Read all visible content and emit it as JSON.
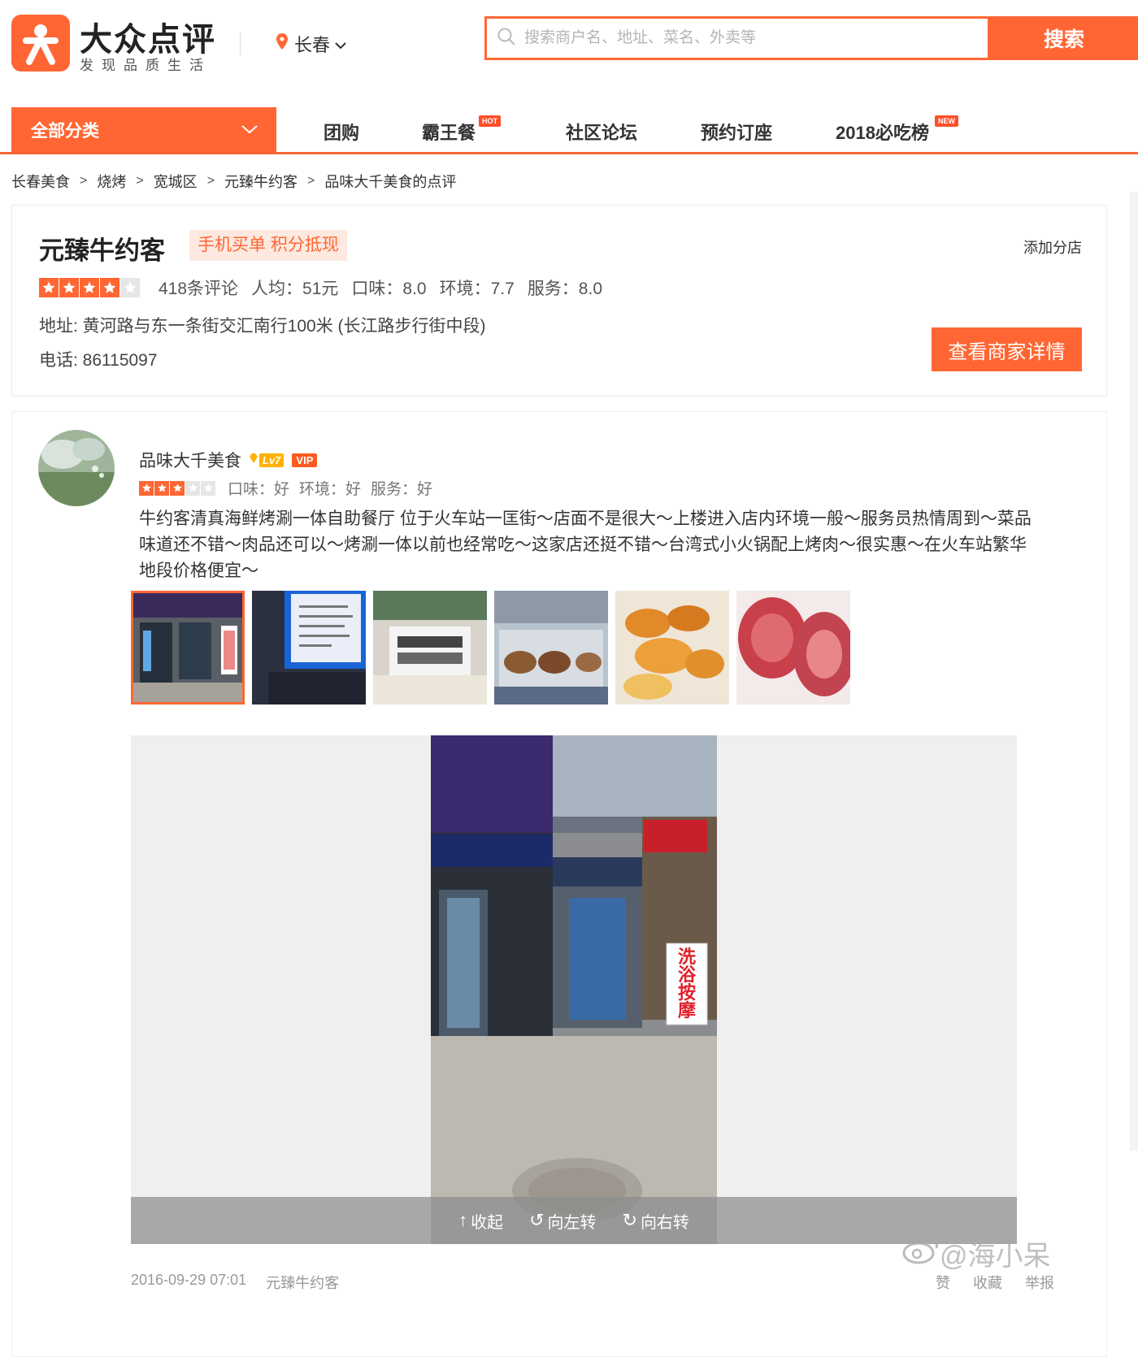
{
  "brand": {
    "name": "大众点评",
    "slogan": "发现品质生活",
    "accent_color": "#ff6633"
  },
  "city": {
    "name": "长春"
  },
  "search": {
    "placeholder": "搜索商户名、地址、菜名、外卖等",
    "button_label": "搜索"
  },
  "nav": {
    "all_categories": "全部分类",
    "items": [
      {
        "label": "团购",
        "badge": ""
      },
      {
        "label": "霸王餐",
        "badge": "HOT"
      },
      {
        "label": "社区论坛",
        "badge": ""
      },
      {
        "label": "预约订座",
        "badge": ""
      },
      {
        "label": "2018必吃榜",
        "badge": "NEW"
      }
    ]
  },
  "breadcrumb": [
    "长春美食",
    "烧烤",
    "宽城区",
    "元臻牛约客",
    "品味大千美食的点评"
  ],
  "shop": {
    "name": "元臻牛约客",
    "tag": "手机买单 积分抵现",
    "add_branch": "添加分店",
    "stars": 4,
    "review_count": "418条评论",
    "avg_price": "人均：51元",
    "taste": "口味：8.0",
    "environment": "环境：7.7",
    "service": "服务：8.0",
    "address": "地址: 黄河路与东一条街交汇南行100米 (长江路步行街中段)",
    "phone": "电话: 86115097",
    "detail_button": "查看商家详情"
  },
  "review": {
    "username": "品味大千美食",
    "level": "Lv7",
    "vip": "VIP",
    "stars": 3,
    "taste": "口味：好",
    "environment": "环境：好",
    "service": "服务：好",
    "text": "牛约客清真海鲜烤涮一体自助餐厅 位于火车站一匡街～店面不是很大～上楼进入店内环境一般～服务员热情周到～菜品味道还不错～肉品还可以～烤涮一体以前也经常吃～这家店还挺不错～台湾式小火锅配上烤肉～很实惠～在火车站繁华地段价格便宜～",
    "photos": [
      {
        "icon": "storefront-photo",
        "active": true
      },
      {
        "icon": "menu-board-photo",
        "active": false
      },
      {
        "icon": "buffet-counter-photo",
        "active": false
      },
      {
        "icon": "freezer-food-photo",
        "active": false
      },
      {
        "icon": "fried-shrimp-photo",
        "active": false
      },
      {
        "icon": "sliced-beef-photo",
        "active": false
      }
    ],
    "viewer": {
      "collapse": "收起",
      "rotate_left": "向左转",
      "rotate_right": "向右转",
      "sign_text": "洗浴按摩"
    },
    "date": "2016-09-29 07:01",
    "shop_link": "元臻牛约客",
    "actions": [
      "赞",
      "收藏",
      "举报"
    ]
  },
  "watermark": "@海小呆"
}
